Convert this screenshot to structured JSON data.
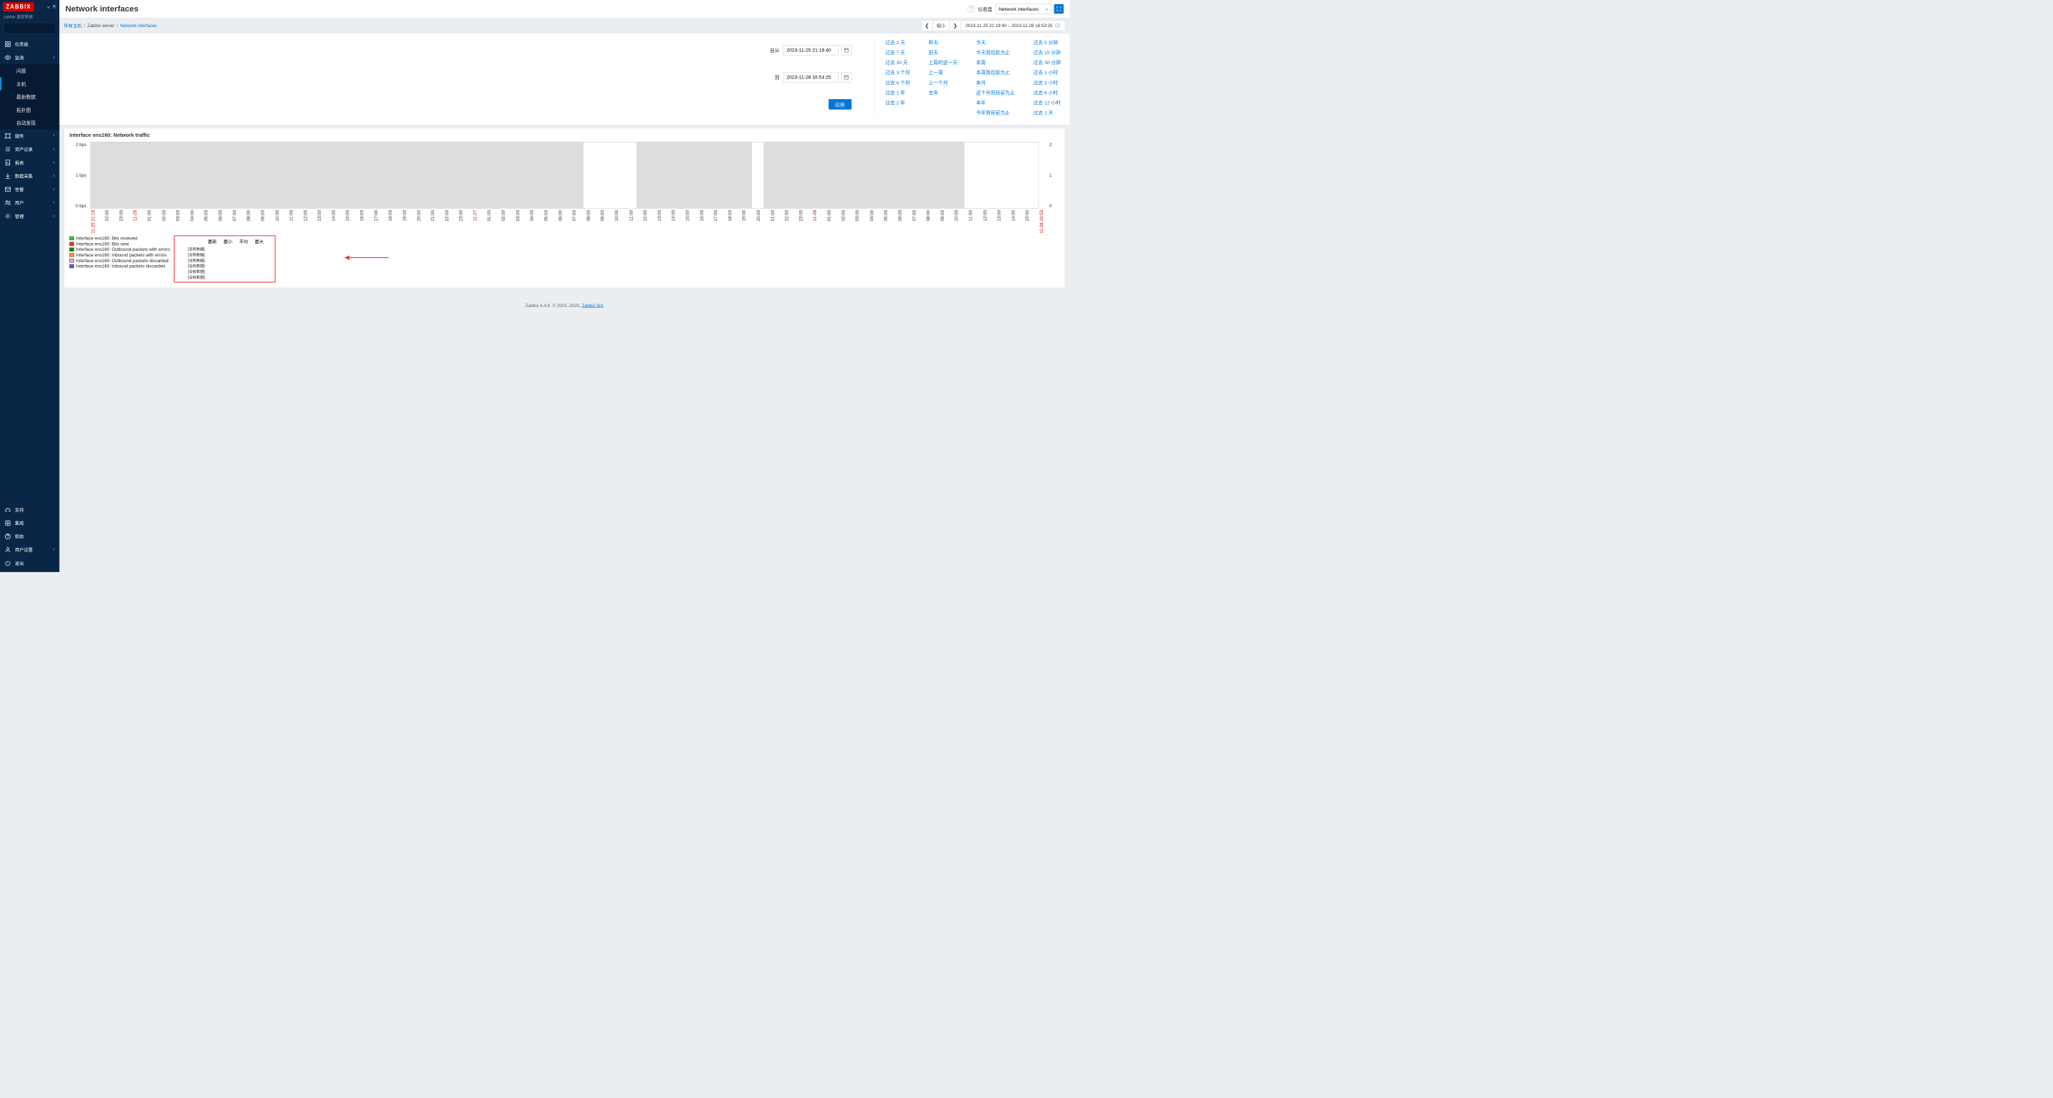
{
  "app": {
    "logo": "ZABBIX",
    "subtitle": "zabbix 监控系统",
    "search_placeholder": ""
  },
  "sidebar": {
    "items": [
      {
        "icon": "dash",
        "label": "仪表盘",
        "expand": ""
      },
      {
        "icon": "eye",
        "label": "监测",
        "expand": "˄",
        "sub": [
          "问题",
          "主机",
          "最新数据",
          "拓扑图",
          "自动发现"
        ],
        "active_sub": 1
      },
      {
        "icon": "svc",
        "label": "服务",
        "expand": "˅"
      },
      {
        "icon": "inv",
        "label": "资产记录",
        "expand": "˅"
      },
      {
        "icon": "rpt",
        "label": "报表",
        "expand": "˅"
      },
      {
        "icon": "dc",
        "label": "数据采集",
        "expand": "˅"
      },
      {
        "icon": "mail",
        "label": "告警",
        "expand": "˅"
      },
      {
        "icon": "usr",
        "label": "用户",
        "expand": "˅"
      },
      {
        "icon": "cog",
        "label": "管理",
        "expand": "˅"
      }
    ],
    "bottom": [
      {
        "icon": "sup",
        "label": "支持"
      },
      {
        "icon": "int",
        "label": "集成"
      },
      {
        "icon": "hlp",
        "label": "帮助"
      },
      {
        "icon": "uset",
        "label": "用户设置",
        "expand": "˅"
      },
      {
        "icon": "off",
        "label": "退出"
      }
    ]
  },
  "header": {
    "title": "Network interfaces",
    "dash_label": "仪表盘",
    "dash_value": "Network interfaces"
  },
  "breadcrumb": {
    "a": "所有主机",
    "b": "Zabbix server",
    "c": "Network interfaces",
    "zoom": "缩小",
    "range": "2023-11-25 21:19:40 – 2023-11-28 16:53:25"
  },
  "time": {
    "from_label": "自从",
    "from": "2023-11-25 21:19:40",
    "to_label": "到",
    "to": "2023-11-28 16:53:25",
    "apply": "应用",
    "quick": [
      [
        "过去 2 天",
        "过去 7 天",
        "过去 30 天",
        "过去 3 个月",
        "过去 6 个月",
        "过去 1 年",
        "过去 2 年"
      ],
      [
        "昨天",
        "前天",
        "上周的这一天",
        "上一周",
        "上一个月",
        "去年"
      ],
      [
        "今天",
        "今天到目前为止",
        "本周",
        "本周到目前为止",
        "本月",
        "这个月到目前为止",
        "本年",
        "今年到目前为止"
      ],
      [
        "过去 5 分钟",
        "过去 15 分钟",
        "过去 30 分钟",
        "过去 1 小时",
        "过去 3 小时",
        "过去 6 小时",
        "过去 12 小时",
        "过去 1 天"
      ]
    ]
  },
  "chart_data": {
    "type": "line",
    "title": "Interface ens160: Network traffic",
    "ylabel": "",
    "ylim": [
      0,
      2
    ],
    "y_unit": "bps",
    "x_span": [
      "11-25 21:19",
      "11-28 16:53"
    ],
    "x_ticks": [
      "11-25 21:19",
      "22:00",
      "23:00",
      "11-26",
      "01:00",
      "02:00",
      "03:00",
      "04:00",
      "05:00",
      "06:00",
      "07:00",
      "08:00",
      "09:00",
      "10:00",
      "11:00",
      "12:00",
      "13:00",
      "14:00",
      "15:00",
      "16:00",
      "17:00",
      "18:00",
      "19:00",
      "20:00",
      "21:00",
      "22:00",
      "23:00",
      "11-27",
      "01:00",
      "02:00",
      "03:00",
      "04:00",
      "05:00",
      "06:00",
      "07:00",
      "08:00",
      "09:00",
      "10:00",
      "11:00",
      "12:00",
      "13:00",
      "14:00",
      "15:00",
      "16:00",
      "17:00",
      "18:00",
      "19:00",
      "20:00",
      "21:00",
      "22:00",
      "23:00",
      "11-28",
      "01:00",
      "02:00",
      "03:00",
      "04:00",
      "05:00",
      "06:00",
      "07:00",
      "08:00",
      "09:00",
      "10:00",
      "11:00",
      "12:00",
      "13:00",
      "14:00",
      "15:00",
      "11-28 16:53"
    ],
    "day_marks": [
      0,
      3,
      27,
      51,
      67
    ],
    "series": [
      {
        "name": "Interface ens160: Bits received",
        "color": "#33cc33",
        "values": []
      },
      {
        "name": "Interface ens160: Bits sent",
        "color": "#ee3333",
        "values": []
      },
      {
        "name": "Interface ens160: Outbound packets with errors",
        "color": "#1a7a1a",
        "values": []
      },
      {
        "name": "Interface ens160: Inbound packets with errors",
        "color": "#ff9922",
        "values": []
      },
      {
        "name": "Interface ens160: Outbound packets discarded",
        "color": "#ff99cc",
        "values": []
      },
      {
        "name": "Interface ens160: Inbound packets discarded",
        "color": "#7755bb",
        "values": []
      }
    ],
    "bands": [
      {
        "start": 0.0,
        "end": 0.52
      },
      {
        "start": 0.576,
        "end": 0.698
      },
      {
        "start": 0.71,
        "end": 0.922
      }
    ],
    "stats_headers": [
      "最新",
      "最小",
      "平均",
      "最大"
    ],
    "nodata": "[没有数据]"
  },
  "legend_cut_text": "Interface ens160: Inbound packets discarded",
  "footer": {
    "text": "Zabbix 6.4.8. © 2001–2023, ",
    "link": "Zabbix SIA"
  }
}
